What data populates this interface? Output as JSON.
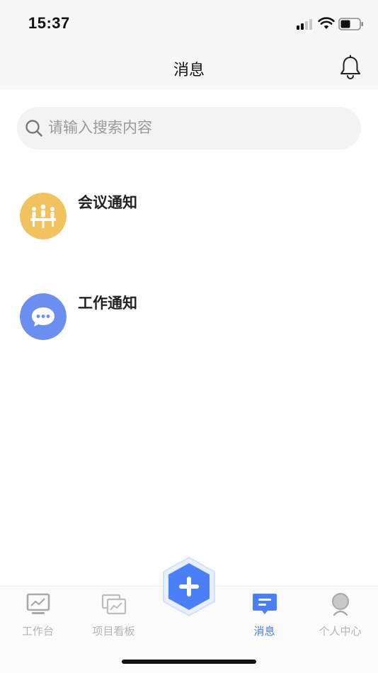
{
  "status_bar": {
    "time": "15:37"
  },
  "nav": {
    "title": "消息"
  },
  "search": {
    "placeholder": "请输入搜索内容"
  },
  "messages": [
    {
      "title": "会议通知",
      "icon": "meeting-icon",
      "color": "#f2c25e"
    },
    {
      "title": "工作通知",
      "icon": "chat-bubble-icon",
      "color": "#6b8ff0"
    }
  ],
  "tabs": [
    {
      "label": "工作台",
      "icon": "monitor-icon",
      "active": false
    },
    {
      "label": "项目看板",
      "icon": "board-icon",
      "active": false
    },
    {
      "label": "消息",
      "icon": "message-icon",
      "active": true
    },
    {
      "label": "个人中心",
      "icon": "profile-icon",
      "active": false
    }
  ],
  "fab": {
    "icon": "plus-icon",
    "color": "#4a7ff7"
  },
  "colors": {
    "accent": "#4a7ff7",
    "inactive": "#b5b5b5",
    "meeting": "#f2c25e",
    "work": "#6b8ff0"
  }
}
